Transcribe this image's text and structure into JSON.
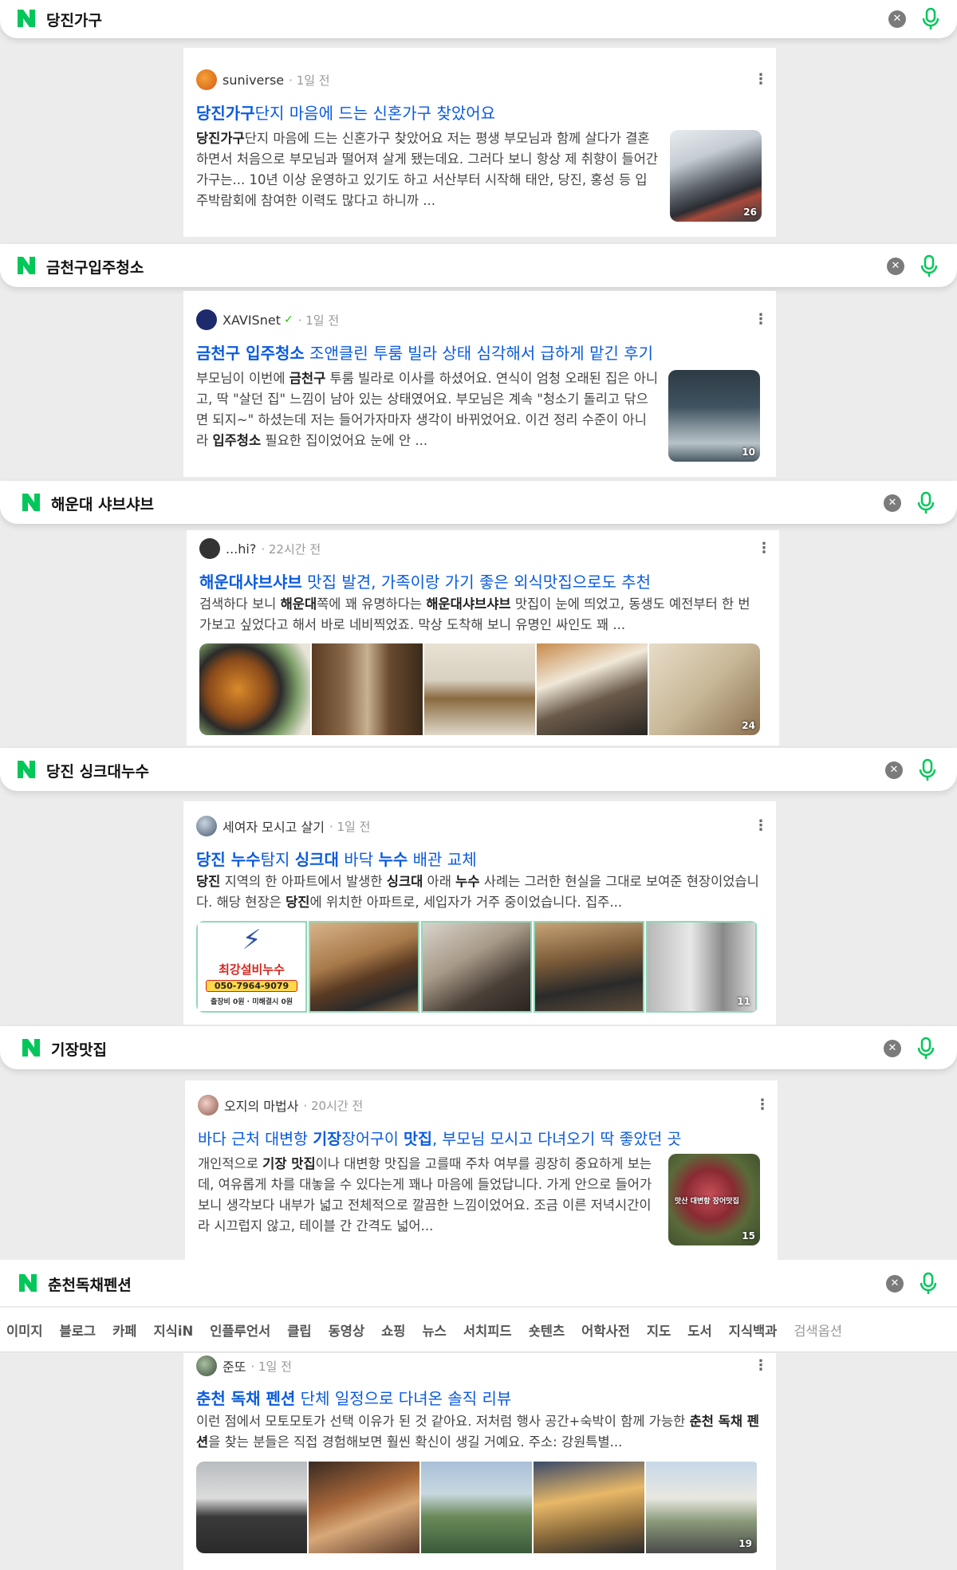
{
  "colors": {
    "naver_green": "#03c75a",
    "link_blue": "#0a5bdf",
    "bg": "#ececec"
  },
  "icons": {
    "logo": "naver-n-logo",
    "clear": "close-circle-icon",
    "mic": "microphone-icon",
    "more": "kebab-menu-icon",
    "verified": "verified-check-icon"
  },
  "blocks": [
    {
      "query": "당진가구",
      "author": "suniverse",
      "time": "1일 전",
      "title": [
        "당진가구",
        "단지 마음에 드는 신혼가구 찾았어요"
      ],
      "snippet": [
        "당진가구",
        "단지 마음에 드는 신혼가구 찾았어요 저는 평생 부모님과 함께 살다가 결혼하면서 처음으로 부모님과 떨어져 살게 됐는데요. 그러다 보니 항상 제 취향이 들어간 가구는... 10년 이상 운영하고 있기도 하고 서산부터 시작해 태안, 당진, 홍성 등 입주박람회에 참여한 이력도 많다고 하니까 ..."
      ],
      "photo_count": "26"
    },
    {
      "query": "금천구입주청소",
      "author": "XAVISnet",
      "time": "1일 전",
      "title": [
        "금천구 입주청소",
        " 조앤클린 투룸 빌라 상태 심각해서 급하게 맡긴 후기"
      ],
      "snippet": [
        "부모님이 이번에 ",
        "금천구",
        " 투룸 빌라로 이사를 하셨어요. 연식이 엄청 오래된 집은 아니고, 딱 \"살던 집\" 느낌이 남아 있는 상태였어요. 부모님은 계속 \"청소기 돌리고 닦으면 되지~\" 하셨는데 저는 들어가자마자 생각이 바뀌었어요. 이건 정리 수준이 아니라 ",
        "입주청소",
        " 필요한 집이었어요 눈에 안 ..."
      ],
      "photo_count": "10"
    },
    {
      "query": "해운대 샤브샤브",
      "author": "...hi?",
      "time": "22시간 전",
      "title": [
        "해운대샤브샤브",
        " 맛집 발견, 가족이랑 가기 좋은 외식맛집으로도 추천"
      ],
      "snippet": [
        "검색하다 보니 ",
        "해운대",
        "쪽에 꽤 유명하다는 ",
        "해운대샤브샤브",
        " 맛집이 눈에 띄었고, 동생도 예전부터 한 번 가보고 싶었다고 해서 바로 네비찍었죠. 막상 도착해 보니 유명인 싸인도 꽤 ..."
      ],
      "photo_count": "24"
    },
    {
      "query": "당진 싱크대누수",
      "author": "세여자 모시고 살기",
      "time": "1일 전",
      "title": [
        "당진 누수",
        "탐지 ",
        "싱크대",
        " 바닥 ",
        "누수",
        " 배관 교체"
      ],
      "snippet": [
        "당진",
        " 지역의 한 아파트에서 발생한 ",
        "싱크대",
        " 아래 ",
        "누수",
        " 사례는 그러한 현실을 그대로 보여준 현장이었습니다. 해당 현장은 ",
        "당진",
        "에 위치한 아파트로, 세입자가 거주 중이었습니다. 집주..."
      ],
      "photo_count": "11",
      "ad": {
        "brand": "최강설비누수",
        "phone": "050-7964-9079",
        "note": "출장비 0원 · 미해결시 0원"
      }
    },
    {
      "query": "기장맛집",
      "author": "오지의 마법사",
      "time": "20시간 전",
      "title": [
        "바다 근처 대변항 ",
        "기장",
        "장어구이 ",
        "맛집",
        ", 부모님 모시고 다녀오기 딱 좋았던 곳"
      ],
      "snippet": [
        "개인적으로 ",
        "기장 맛집",
        "이나 대변항 맛집을 고를때 주차 여부를 굉장히 중요하게 보는데, 여유롭게 차를 대놓을 수 있다는게 꽤나 마음에 들었답니다. 가게 안으로 들어가 보니 생각보다 내부가 넓고 전체적으로 깔끔한 느낌이었어요. 조금 이른 저녁시간이라 시끄럽지 않고, 테이블 간 간격도 넓어..."
      ],
      "photo_count": "15",
      "thumb_caption": "맛산 대변항 장어맛집"
    },
    {
      "query": "춘천독채펜션",
      "author": "준또",
      "time": "1일 전",
      "title": [
        "춘천 독채 펜션",
        " 단체 일정으로 다녀온 솔직 리뷰"
      ],
      "snippet": [
        "이런 점에서 모토모토가 선택 이유가 된 것 같아요. 저처럼 행사 공간+숙박이 함께 가능한 ",
        "춘천 독채 펜션",
        "을 찾는 분들은 직접 경험해보면 훨씬 확신이 생길 거예요. 주소: 강원특별..."
      ],
      "photo_count": "19",
      "tabs": [
        "이미지",
        "블로그",
        "카페",
        "지식iN",
        "인플루언서",
        "클립",
        "동영상",
        "쇼핑",
        "뉴스",
        "서치피드",
        "숏텐츠",
        "어학사전",
        "지도",
        "도서",
        "지식백과",
        "검색옵션"
      ]
    }
  ]
}
